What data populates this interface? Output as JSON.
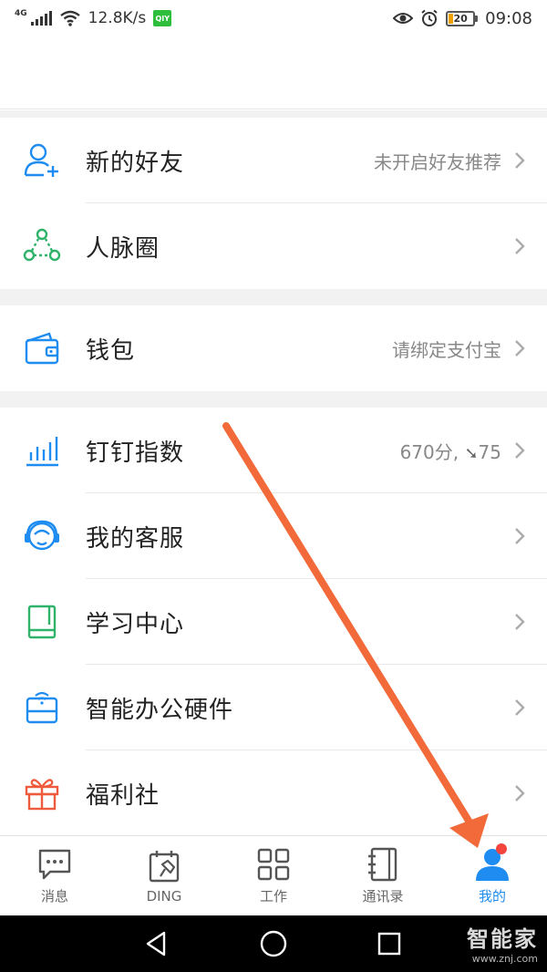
{
  "status_bar": {
    "network": "4G",
    "speed": "12.8K/s",
    "app_badge": "QIY",
    "battery": "20",
    "time": "09:08"
  },
  "menu": {
    "groups": [
      [
        {
          "label": "新的好友",
          "value": "未开启好友推荐",
          "icon": "add-friend-icon"
        },
        {
          "label": "人脉圈",
          "value": "",
          "icon": "network-circle-icon"
        }
      ],
      [
        {
          "label": "钱包",
          "value": "请绑定支付宝",
          "icon": "wallet-icon"
        }
      ],
      [
        {
          "label": "钉钉指数",
          "value": "670分, ",
          "value_extra": "75",
          "icon": "bar-chart-icon"
        },
        {
          "label": "我的客服",
          "value": "",
          "icon": "customer-service-icon"
        },
        {
          "label": "学习中心",
          "value": "",
          "icon": "book-icon"
        },
        {
          "label": "智能办公硬件",
          "value": "",
          "icon": "smart-hardware-icon"
        },
        {
          "label": "福利社",
          "value": "",
          "icon": "gift-icon"
        }
      ]
    ]
  },
  "tabs": [
    {
      "label": "消息",
      "icon": "message-icon",
      "active": false
    },
    {
      "label": "DING",
      "icon": "ding-icon",
      "active": false
    },
    {
      "label": "工作",
      "icon": "work-grid-icon",
      "active": false
    },
    {
      "label": "通讯录",
      "icon": "contacts-icon",
      "active": false
    },
    {
      "label": "我的",
      "icon": "profile-icon",
      "active": true
    }
  ],
  "watermark": {
    "main": "智能家",
    "sub": "www.znj.com"
  },
  "colors": {
    "accent": "#1e8cf0",
    "green": "#2fb36a",
    "orange_red": "#f05a3c",
    "arrow": "#f36a3a",
    "badge": "#f3453d"
  }
}
